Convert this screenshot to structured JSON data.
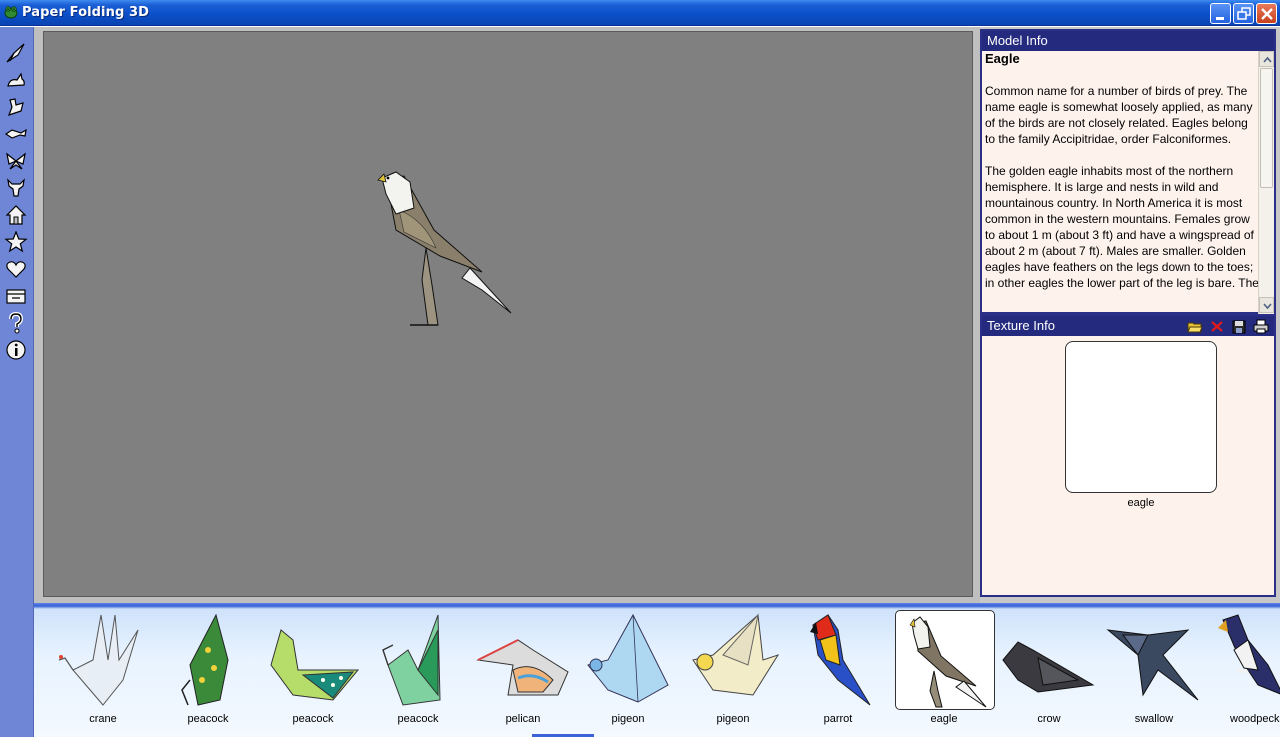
{
  "window": {
    "title": "Paper Folding 3D"
  },
  "left_toolbar": {
    "items": [
      {
        "icon": "bird-icon"
      },
      {
        "icon": "rabbit-icon"
      },
      {
        "icon": "rooster-icon"
      },
      {
        "icon": "fish-icon"
      },
      {
        "icon": "butterfly-icon"
      },
      {
        "icon": "bull-icon"
      },
      {
        "icon": "house-icon"
      },
      {
        "icon": "star-icon"
      },
      {
        "icon": "heart-icon"
      },
      {
        "icon": "box-icon"
      },
      {
        "icon": "help-icon"
      },
      {
        "icon": "info-icon"
      }
    ]
  },
  "model_info": {
    "header": "Model Info",
    "name": "Eagle",
    "paragraphs": [
      "Common name for a number of birds of prey. The name eagle is somewhat loosely applied, as many of the birds are not closely related. Eagles belong to the family Accipitridae, order Falconiformes.",
      "The golden eagle inhabits most of the northern hemisphere. It is large and nests in wild and mountainous country. In North America it is most common in the western mountains. Females grow to about 1 m (about 3 ft) and have a wingspread of about 2 m (about 7 ft). Males are smaller. Golden eagles have feathers on the legs down to the toes; in other eagles the lower part of the leg is bare. The"
    ]
  },
  "texture_info": {
    "header": "Texture Info",
    "texture_name": "eagle",
    "tools": [
      "open-folder-icon",
      "delete-icon",
      "save-icon",
      "print-icon"
    ]
  },
  "models": [
    {
      "label": "crane"
    },
    {
      "label": "peacock"
    },
    {
      "label": "peacock"
    },
    {
      "label": "peacock"
    },
    {
      "label": "pelican"
    },
    {
      "label": "pigeon"
    },
    {
      "label": "pigeon"
    },
    {
      "label": "parrot"
    },
    {
      "label": "eagle",
      "selected": true
    },
    {
      "label": "crow"
    },
    {
      "label": "swallow"
    },
    {
      "label": "woodpecker"
    }
  ],
  "colors": {
    "title_bar": "#0b4fc8",
    "panel_header": "#242b7e",
    "viewport": "#808080",
    "toolbar": "#6f86d6",
    "panel_background": "#fdf3ec"
  }
}
